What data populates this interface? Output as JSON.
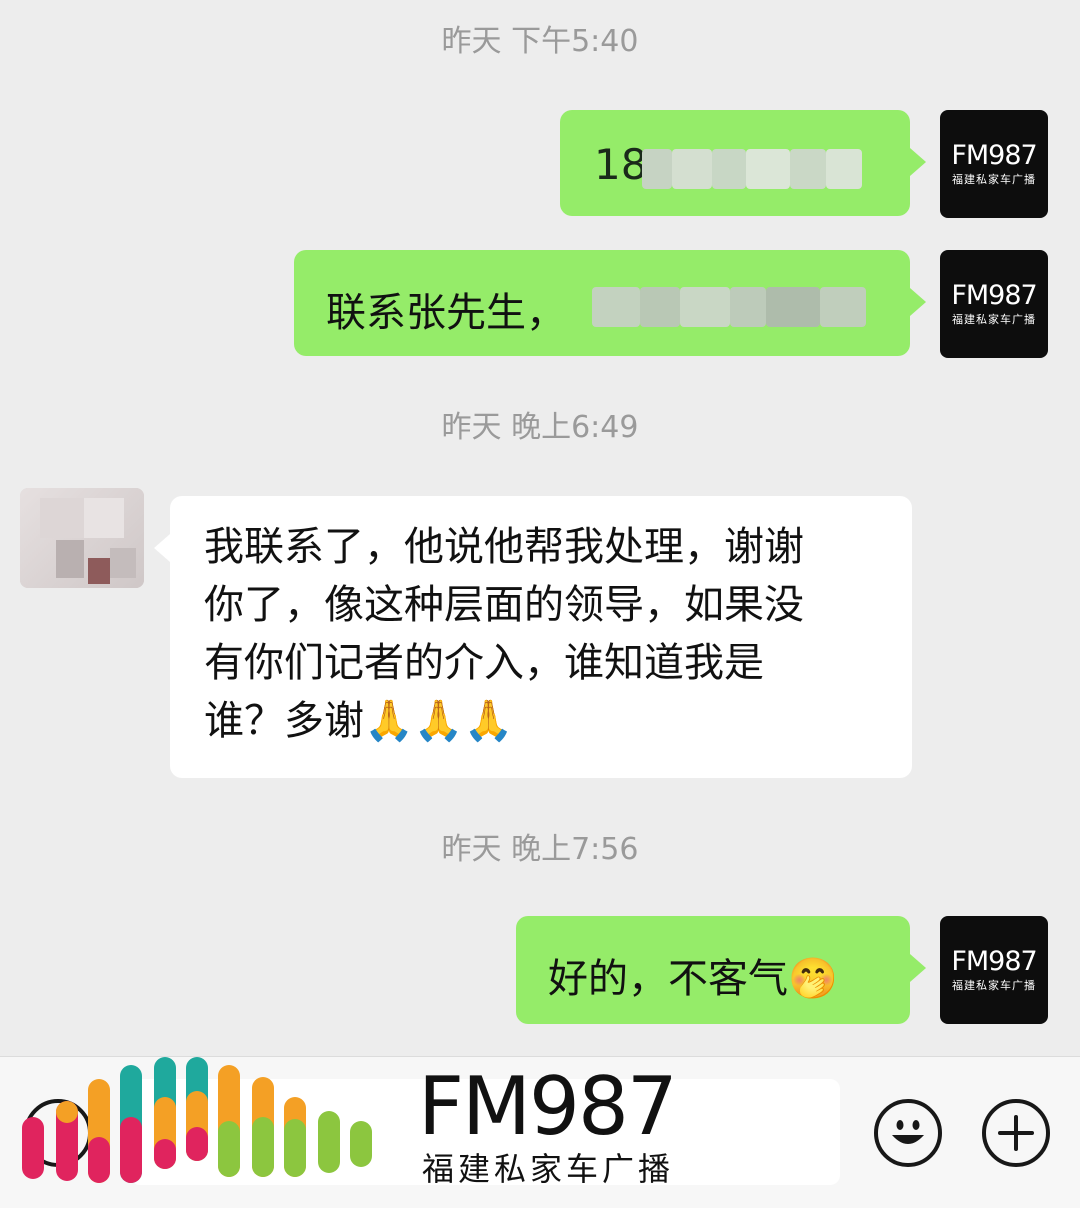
{
  "conversation": {
    "timestamps": [
      "昨天 下午5:40",
      "昨天 晚上6:49",
      "昨天 晚上7:56"
    ],
    "messages": [
      {
        "side": "sent",
        "text": "18",
        "blurred": true
      },
      {
        "side": "sent",
        "text": "联系张先生，",
        "blurred": true
      },
      {
        "side": "received",
        "lines": [
          "我联系了，他说他帮我处理，谢谢",
          "你了，像这种层面的领导，如果没",
          "有你们记者的介入，谁知道我是",
          "谁？多谢🙏🙏🙏"
        ]
      },
      {
        "side": "sent",
        "text": "好的，不客气🤭"
      }
    ]
  },
  "avatar": {
    "logo": "FM987",
    "subtitle": "福建私家车广播"
  },
  "footer": {
    "brand_name": "FM987",
    "brand_subtitle": "福建私家车广播"
  },
  "colors": {
    "background": "#ededed",
    "sent_bubble": "#95ec69",
    "received_bubble": "#ffffff",
    "avatar_bg": "#0d0d0d"
  },
  "icons": {
    "emoji_button": "smiley-face-icon",
    "more_button": "plus-icon"
  }
}
